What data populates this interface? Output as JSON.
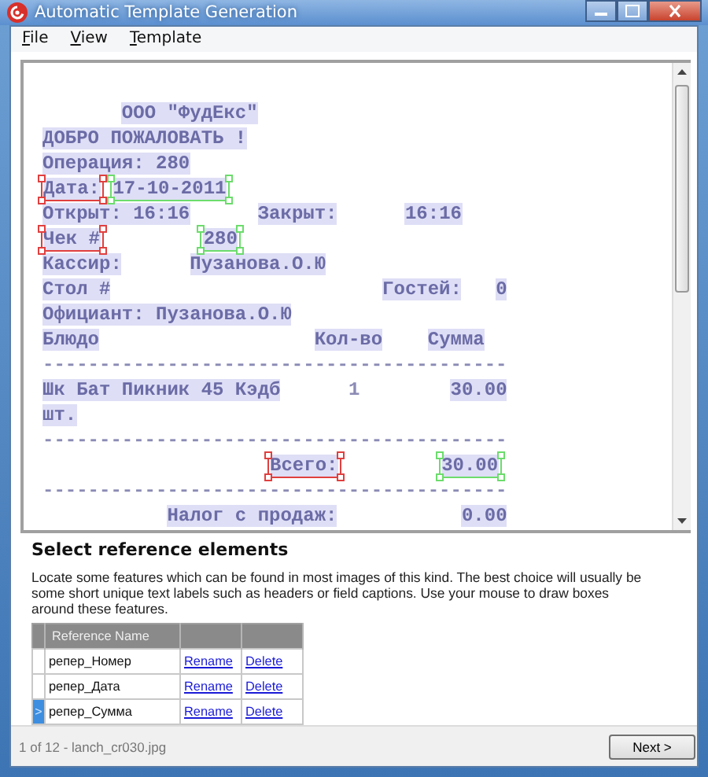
{
  "window": {
    "title": "Automatic Template Generation"
  },
  "menu": [
    {
      "label": "File"
    },
    {
      "label": "View"
    },
    {
      "label": "Template"
    }
  ],
  "receipt_lines": [
    [
      {
        "text": "       ООО \"ФудЕкс\"",
        "highlighted": true,
        "kind": "plain"
      }
    ],
    [
      {
        "text": "ДОБРО ПОЖАЛОВАТЬ !",
        "highlighted": true,
        "kind": "plain"
      }
    ],
    [
      {
        "text": "Операция: 280",
        "highlighted": true,
        "kind": "plain"
      }
    ],
    [
      {
        "text": "Дата:",
        "highlighted": true,
        "kind": "reference"
      },
      {
        "text": " 17-10-2011",
        "highlighted": true,
        "kind": "field"
      }
    ],
    [
      {
        "text": "Открыт: 16:16",
        "highlighted": true,
        "kind": "plain"
      },
      {
        "text": "      Закрыт:",
        "highlighted": true,
        "kind": "plain"
      },
      {
        "text": "      16:16",
        "highlighted": true,
        "kind": "plain"
      }
    ],
    [
      {
        "text": "Чек #",
        "highlighted": true,
        "kind": "reference"
      },
      {
        "text": "         280",
        "highlighted": true,
        "kind": "field"
      }
    ],
    [
      {
        "text": "Кассир:",
        "highlighted": true,
        "kind": "plain"
      },
      {
        "text": "      Пузанова.О.Ю",
        "highlighted": true,
        "kind": "plain"
      }
    ],
    [
      {
        "text": "Стол #",
        "highlighted": true,
        "kind": "plain"
      },
      {
        "text": "                        Гостей:",
        "highlighted": true,
        "kind": "plain"
      },
      {
        "text": "   0",
        "highlighted": true,
        "kind": "plain"
      }
    ],
    [
      {
        "text": "Официант: Пузанова.О.Ю",
        "highlighted": true,
        "kind": "plain"
      }
    ],
    [
      {
        "text": "Блюдо",
        "highlighted": true,
        "kind": "plain"
      },
      {
        "text": "                   Кол-во",
        "highlighted": true,
        "kind": "plain"
      },
      {
        "text": "    Сумма",
        "highlighted": true,
        "kind": "plain"
      }
    ],
    [
      {
        "text": "-----------------------------------------",
        "highlighted": false,
        "kind": "plain"
      }
    ],
    [
      {
        "text": "Шк Бат Пикник 45 Кэдб",
        "highlighted": true,
        "kind": "plain"
      },
      {
        "text": "      1",
        "highlighted": false,
        "kind": "plain"
      },
      {
        "text": "        30.00",
        "highlighted": true,
        "kind": "plain"
      }
    ],
    [
      {
        "text": "шт.",
        "highlighted": true,
        "kind": "plain"
      }
    ],
    [
      {
        "text": "-----------------------------------------",
        "highlighted": false,
        "kind": "plain"
      }
    ],
    [
      {
        "text": "                    Всего:",
        "highlighted": true,
        "kind": "reference"
      },
      {
        "text": "         30.00",
        "highlighted": true,
        "kind": "field"
      }
    ],
    [
      {
        "text": "-----------------------------------------",
        "highlighted": false,
        "kind": "plain"
      }
    ],
    [
      {
        "text": "           Налог с продаж:",
        "highlighted": true,
        "kind": "plain"
      },
      {
        "text": "           0.00",
        "highlighted": true,
        "kind": "plain"
      }
    ]
  ],
  "section": {
    "title": "Select reference elements",
    "description": "Locate some features which can be found in most images of this kind. The best choice will usually be some short unique text labels such as headers or field captions. Use your mouse to draw boxes around these features."
  },
  "table": {
    "columns": [
      "Reference Name"
    ],
    "rows": [
      {
        "name": "репер_Номер",
        "rename": "Rename",
        "delete": "Delete",
        "selected": false,
        "marker": ""
      },
      {
        "name": "репер_Дата",
        "rename": "Rename",
        "delete": "Delete",
        "selected": false,
        "marker": ""
      },
      {
        "name": "репер_Сумма",
        "rename": "Rename",
        "delete": "Delete",
        "selected": true,
        "marker": ">"
      }
    ]
  },
  "status_bar": {
    "text": "1 of 12 - lanch_cr030.jpg",
    "next_button": "Next >"
  }
}
